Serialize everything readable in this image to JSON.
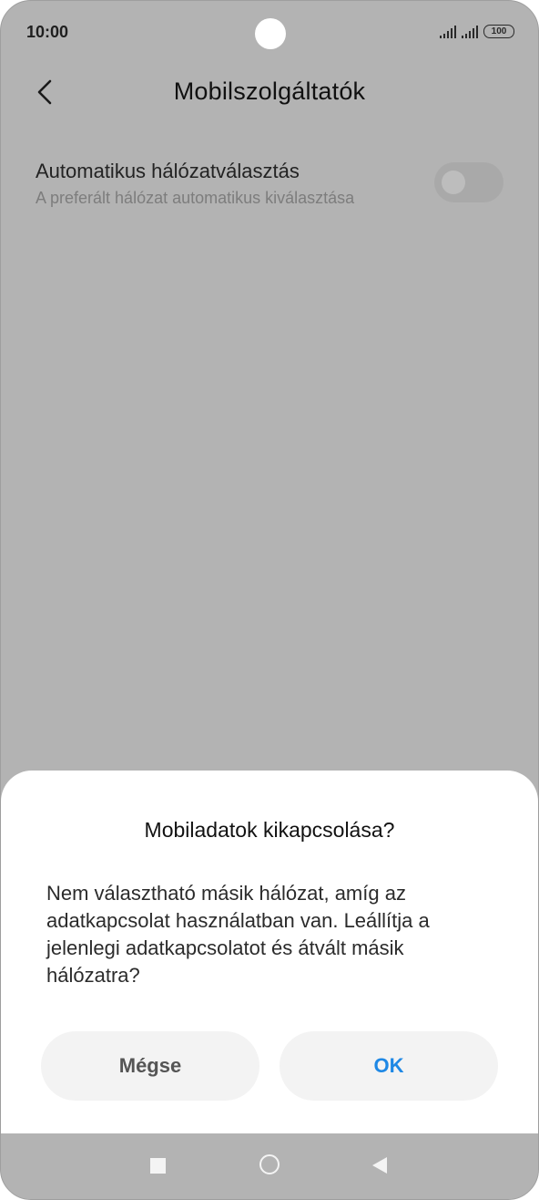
{
  "status_bar": {
    "time": "10:00",
    "battery": "100"
  },
  "header": {
    "title": "Mobilszolgáltatók",
    "back_icon": "chevron-left-icon"
  },
  "setting": {
    "title": "Automatikus hálózatválasztás",
    "subtitle": "A preferált hálózat automatikus kiválasztása",
    "toggle_on": false
  },
  "dialog": {
    "title": "Mobiladatok kikapcsolása?",
    "message": "Nem választható másik hálózat, amíg az adatkapcsolat használatban van. Leállítja a jelenlegi adatkapcsolatot és átvált másik hálózatra?",
    "cancel_label": "Mégse",
    "ok_label": "OK"
  },
  "colors": {
    "scrim": "#b3b3b3",
    "accent": "#1e88e5",
    "button_bg": "#f3f3f3"
  },
  "nav_bar": {
    "icons": [
      "recents-square-icon",
      "home-circle-icon",
      "back-triangle-icon"
    ]
  }
}
